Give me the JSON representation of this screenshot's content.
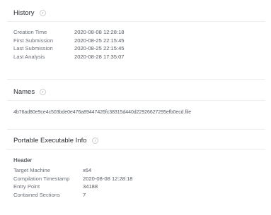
{
  "history": {
    "title": "History",
    "rows": [
      {
        "key": "Creation Time",
        "value": "2020-08-08 12:28:18"
      },
      {
        "key": "First Submission",
        "value": "2020-08-25 22:15:45"
      },
      {
        "key": "Last Submission",
        "value": "2020-08-25 22:15:45"
      },
      {
        "key": "Last Analysis",
        "value": "2020-08-28 17:35:07"
      }
    ]
  },
  "names": {
    "title": "Names",
    "file": "4b76ad80e9ce4c503bde0e476a89447426fc38315d440d22926627295efb0ecd.file"
  },
  "pe": {
    "title": "Portable Executable Info",
    "header_title": "Header",
    "rows": [
      {
        "key": "Target Machine",
        "value": "x64"
      },
      {
        "key": "Compilation Timestamp",
        "value": "2020-08-08 12:28:18"
      },
      {
        "key": "Entry Point",
        "value": "34188"
      },
      {
        "key": "Contained Sections",
        "value": "7"
      }
    ]
  },
  "icons": {
    "info": "info-circle-icon"
  }
}
